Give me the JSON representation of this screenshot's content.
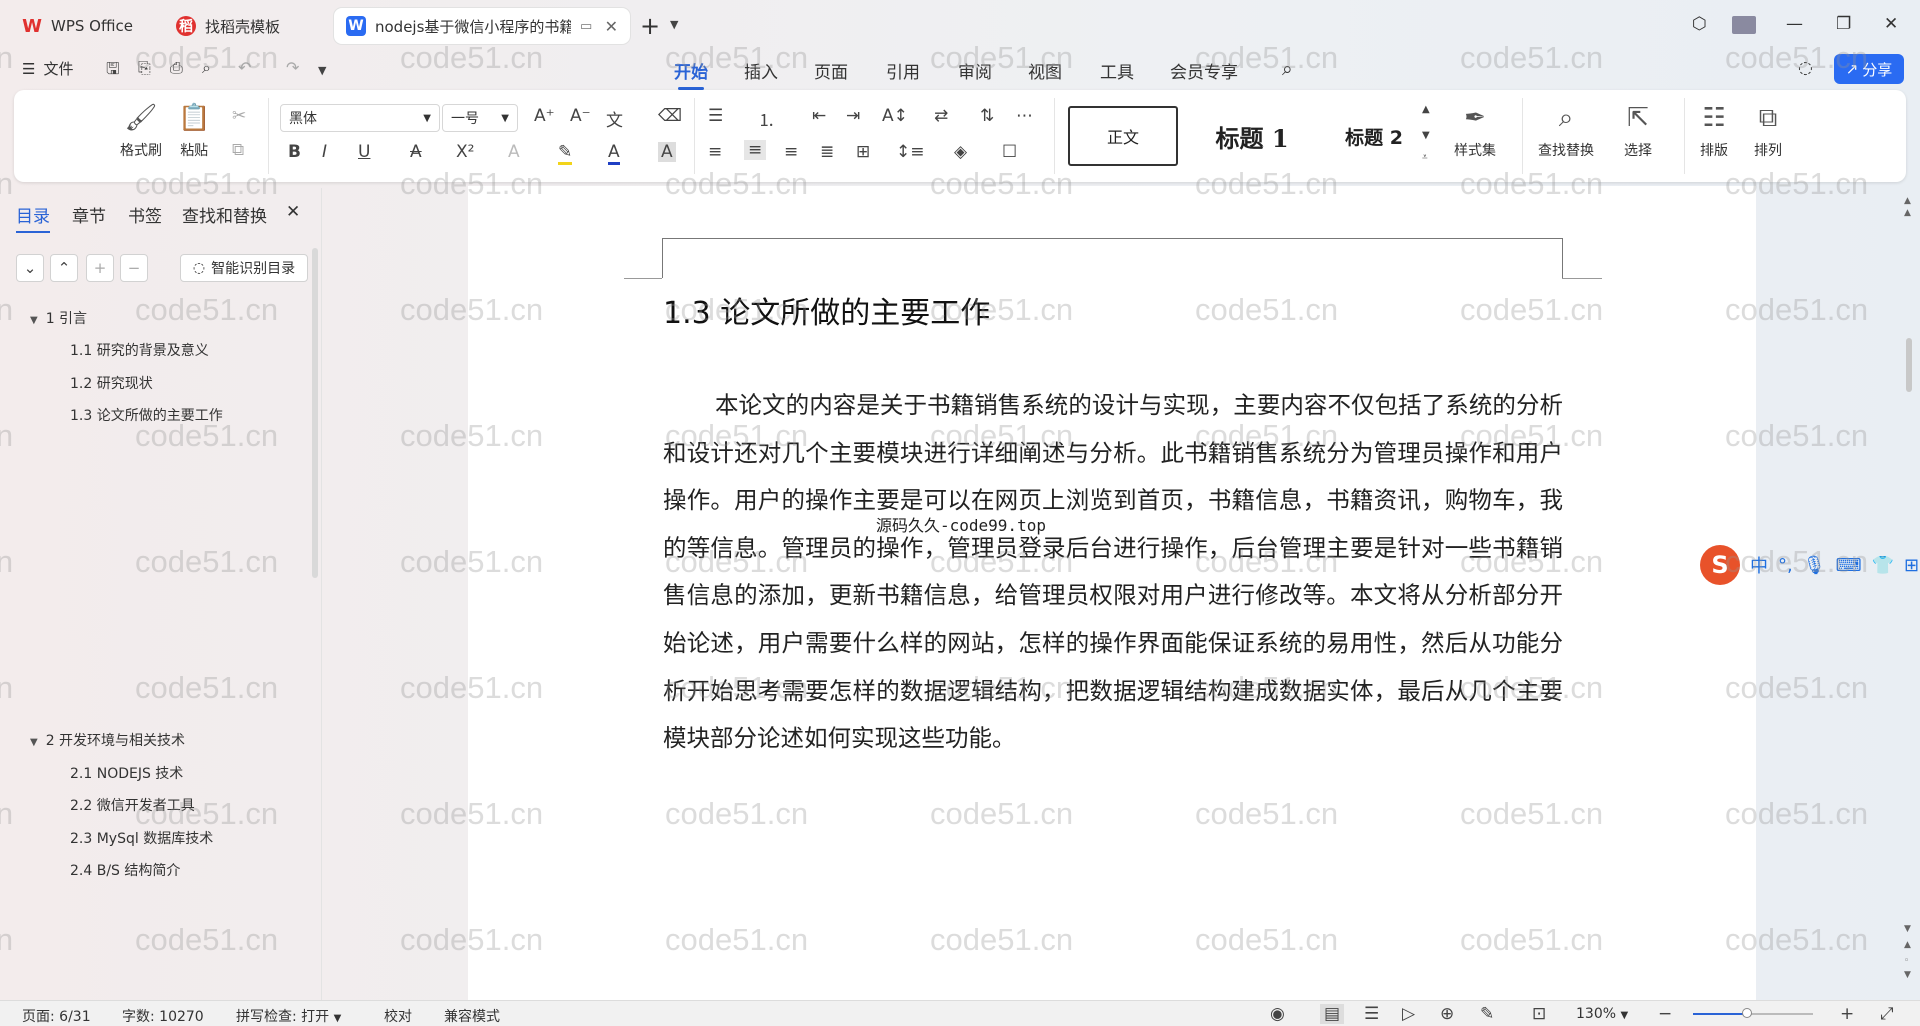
{
  "tabs": [
    {
      "label": "WPS Office",
      "active": false
    },
    {
      "label": "找稻壳模板",
      "active": false
    },
    {
      "label": "nodejs基于微信小程序的书籍",
      "active": true
    }
  ],
  "menu": {
    "file": "文件",
    "tabs": [
      "开始",
      "插入",
      "页面",
      "引用",
      "审阅",
      "视图",
      "工具",
      "会员专享"
    ],
    "active_tab": "开始",
    "share": "分享"
  },
  "ribbon": {
    "format_painter": "格式刷",
    "paste": "粘贴",
    "font_name": "黑体",
    "font_size": "一号",
    "styles": {
      "normal": "正文",
      "h1": "标题 1",
      "h2": "标题 2"
    },
    "style_set": "样式集",
    "find_replace": "查找替换",
    "select": "选择",
    "layout": "排版",
    "arrange": "排列"
  },
  "nav": {
    "tabs": [
      "目录",
      "章节",
      "书签",
      "查找和替换"
    ],
    "active_tab": "目录",
    "ai_toc": "智能识别目录",
    "toc": [
      {
        "level": 1,
        "label": "1  引言"
      },
      {
        "level": 2,
        "label": "1.1 研究的背景及意义"
      },
      {
        "level": 2,
        "label": "1.2 研究现状"
      },
      {
        "level": 2,
        "label": "1.3 论文所做的主要工作"
      },
      {
        "level": 1,
        "label": "2  开发环境与相关技术"
      },
      {
        "level": 2,
        "label": "2.1 NODEJS 技术"
      },
      {
        "level": 2,
        "label": "2.2 微信开发者工具"
      },
      {
        "level": 2,
        "label": "2.3 MySql 数据库技术"
      },
      {
        "level": 2,
        "label": "2.4 B/S 结构简介"
      }
    ]
  },
  "document": {
    "heading": "1.3 论文所做的主要工作",
    "body": "本论文的内容是关于书籍销售系统的设计与实现，主要内容不仅包括了系统的分析和设计还对几个主要模块进行详细阐述与分析。此书籍销售系统分为管理员操作和用户操作。用户的操作主要是可以在网页上浏览到首页，书籍信息，书籍资讯，购物车，我的等信息。管理员的操作，管理员登录后台进行操作，后台管理主要是针对一些书籍销售信息的添加，更新书籍信息，给管理员权限对用户进行修改等。本文将从分析部分开始论述，用户需要什么样的网站，怎样的操作界面能保证系统的易用性，然后从功能分析开始思考需要怎样的数据逻辑结构，把数据逻辑结构建成数据实体，最后从几个主要模块部分论述如何实现这些功能。",
    "overlay": "源码久久-code99.top"
  },
  "watermark": "code51.cn",
  "ime": {
    "mode": "中"
  },
  "status": {
    "page": "页面: 6/31",
    "words": "字数: 10270",
    "spell": "拼写检查: 打开",
    "proof": "校对",
    "compat": "兼容模式",
    "zoom": "130%",
    "zoom_fraction": 0.45
  },
  "colors": {
    "accent": "#2a63d6",
    "share": "#2a6bf2",
    "wps_red": "#e0312f",
    "ime": "#e8522a"
  }
}
